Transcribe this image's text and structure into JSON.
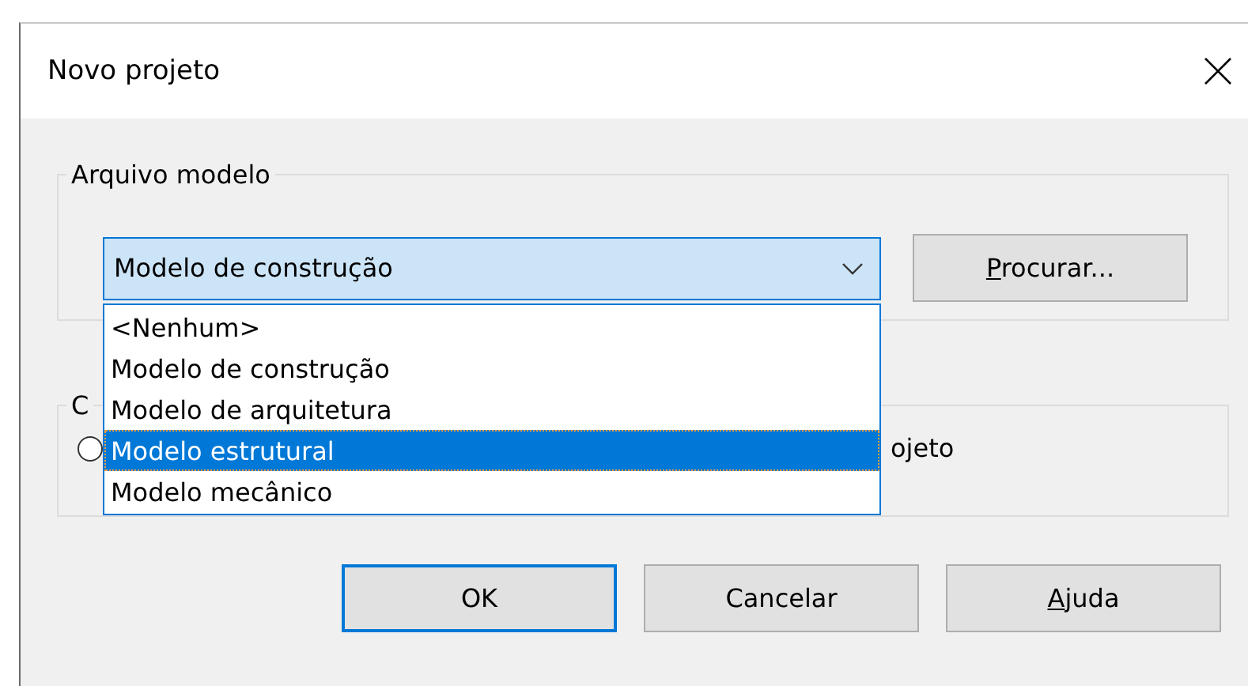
{
  "window": {
    "title": "Novo projeto"
  },
  "template_group": {
    "legend": "Arquivo modelo",
    "combo": {
      "value": "Modelo de construção",
      "expanded": true,
      "options": [
        {
          "label": "<Nenhum>",
          "highlighted": false
        },
        {
          "label": "Modelo de construção",
          "highlighted": false
        },
        {
          "label": "Modelo de arquitetura",
          "highlighted": false
        },
        {
          "label": "Modelo estrutural",
          "highlighted": true
        },
        {
          "label": "Modelo mecânico",
          "highlighted": false
        }
      ]
    },
    "browse_button": {
      "label": "Procurar...",
      "mnemonic_first": true
    }
  },
  "second_group": {
    "legend": "C",
    "option_selected": false,
    "option_label": "ojeto"
  },
  "buttons": [
    {
      "label": "OK",
      "default": true,
      "mnemonic_first": false
    },
    {
      "label": "Cancelar",
      "default": false,
      "mnemonic_first": false
    },
    {
      "label": "Ajuda",
      "default": false,
      "mnemonic_first": true
    }
  ]
}
